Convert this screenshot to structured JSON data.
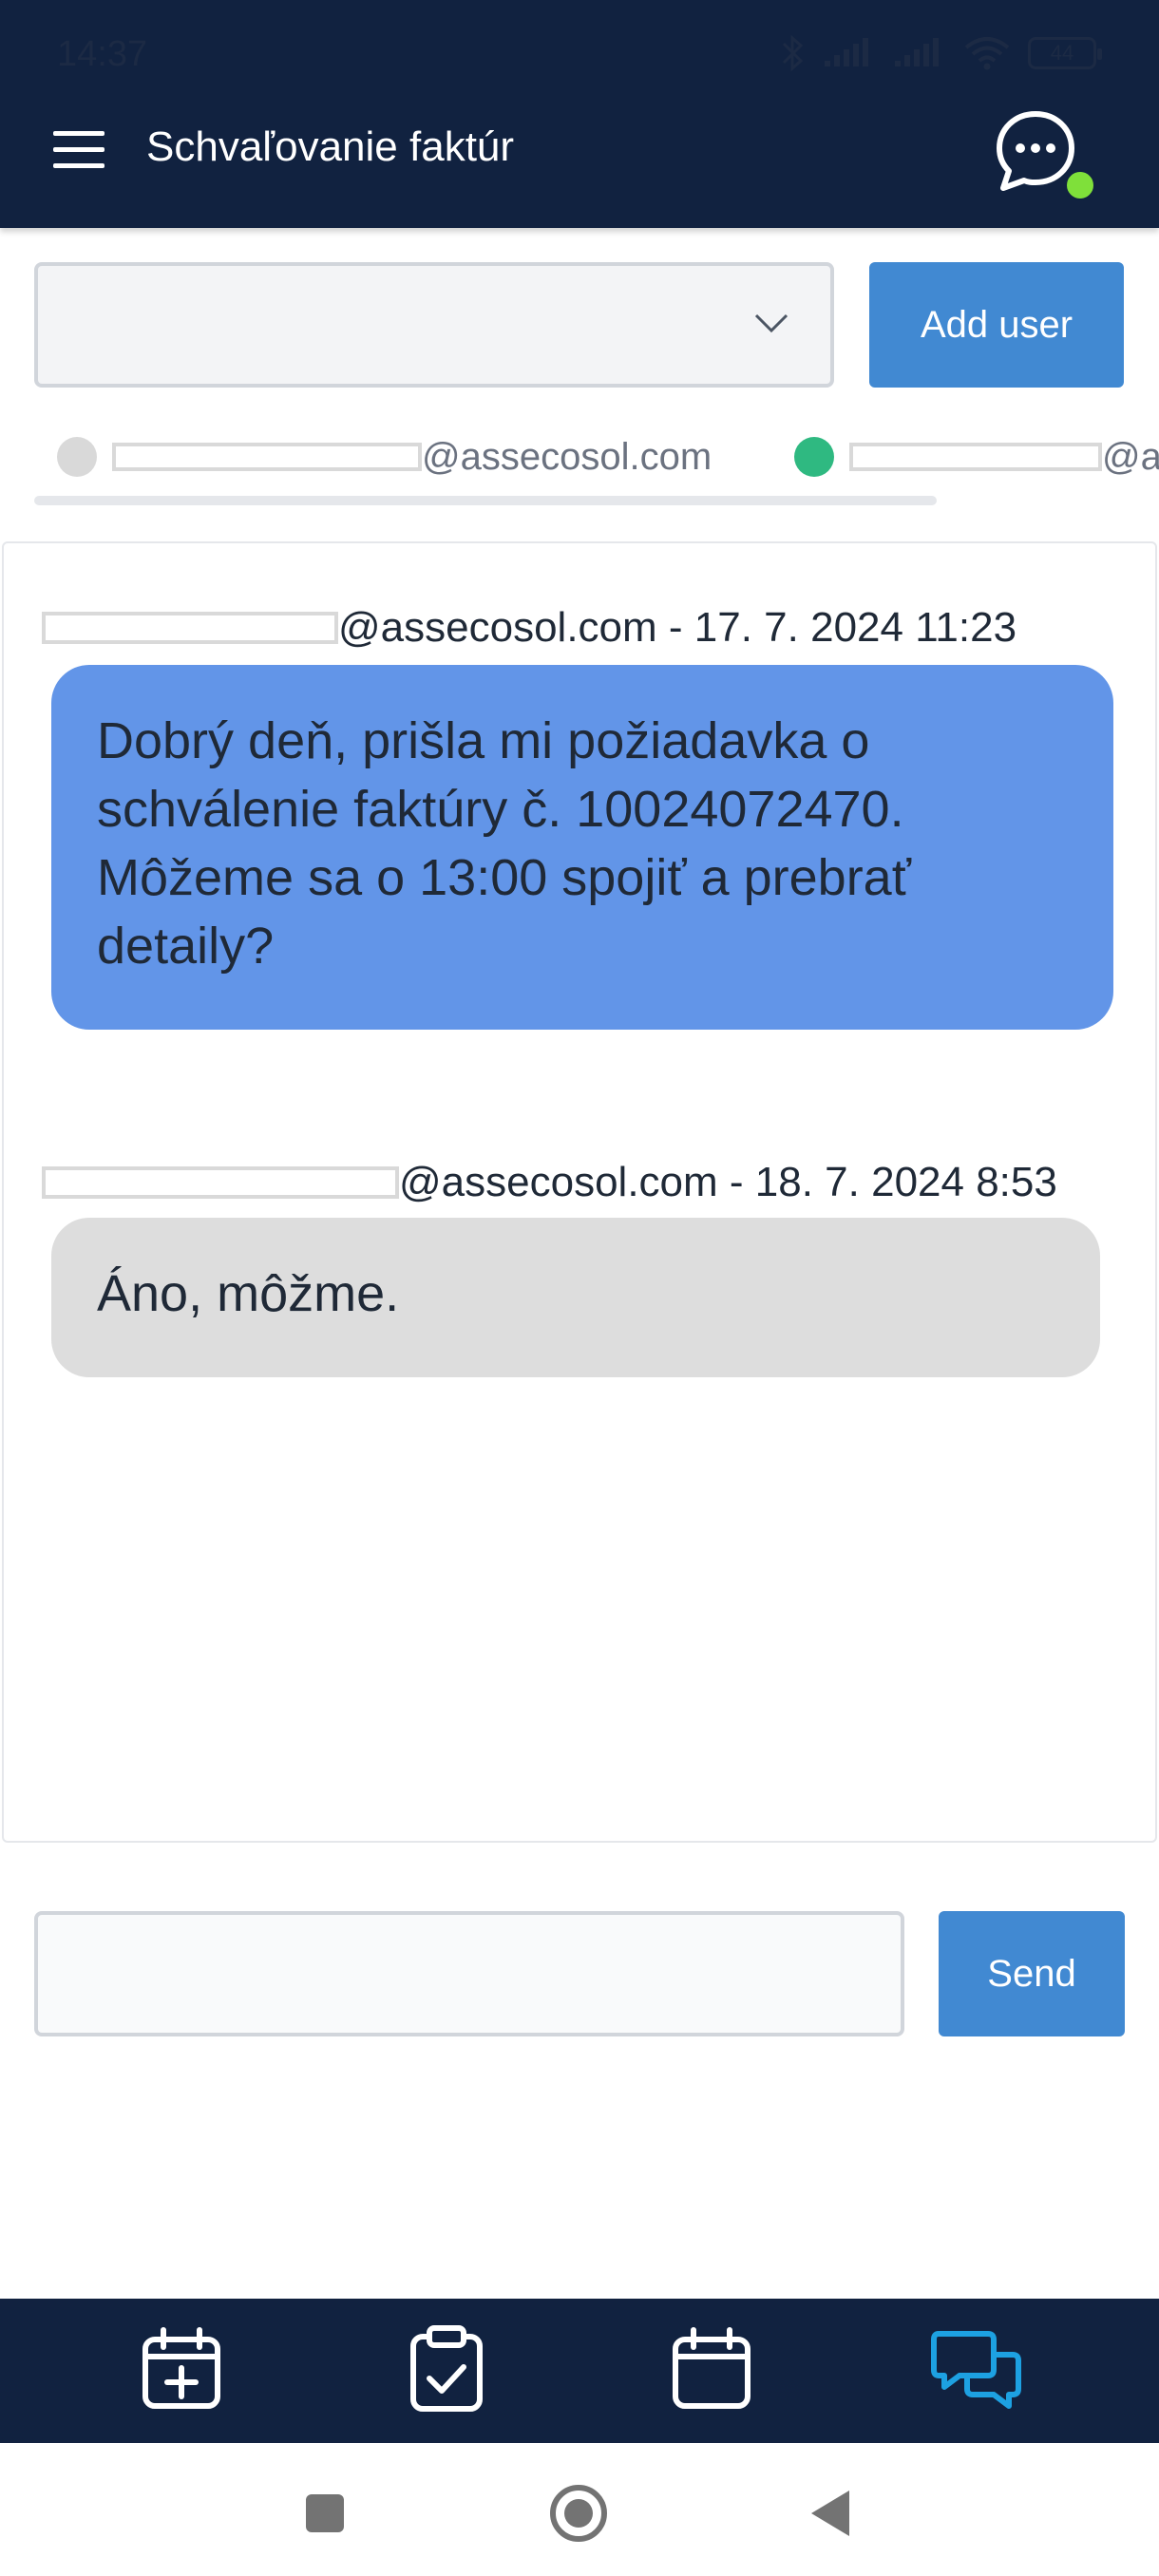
{
  "status_bar": {
    "time": "14:37",
    "battery": "44"
  },
  "header": {
    "title": "Schvaľovanie faktúr"
  },
  "user_select": {
    "value": ""
  },
  "add_user_label": "Add user",
  "participants": [
    {
      "email_suffix": "@assecosol.com",
      "status_color": "#d9d9d9"
    },
    {
      "email_suffix": "@a",
      "status_color": "#2fb981"
    }
  ],
  "messages": [
    {
      "sender_suffix": "@assecosol.com",
      "timestamp": "17. 7. 2024 11:23",
      "text": "Dobrý deň, prišla mi požiadavka o schválenie faktúry č. 10024072470. Môžeme sa o 13:00 spojiť a prebrať detaily?",
      "color": "#6295e8"
    },
    {
      "sender_suffix": "@assecosol.com",
      "timestamp": "18. 7. 2024 8:53",
      "text": "Áno, môžme.",
      "color": "#dddddd"
    }
  ],
  "compose": {
    "placeholder": "",
    "send_label": "Send"
  },
  "bottom_nav": [
    {
      "icon": "calendar-plus-icon",
      "active": false
    },
    {
      "icon": "clipboard-check-icon",
      "active": false
    },
    {
      "icon": "calendar-icon",
      "active": false
    },
    {
      "icon": "chat-bubbles-icon",
      "active": true
    }
  ],
  "colors": {
    "header": "#112240",
    "accent": "#4189d2",
    "active_nav": "#1da1e2",
    "online": "#7fe03a"
  },
  "meta_separator": " - "
}
